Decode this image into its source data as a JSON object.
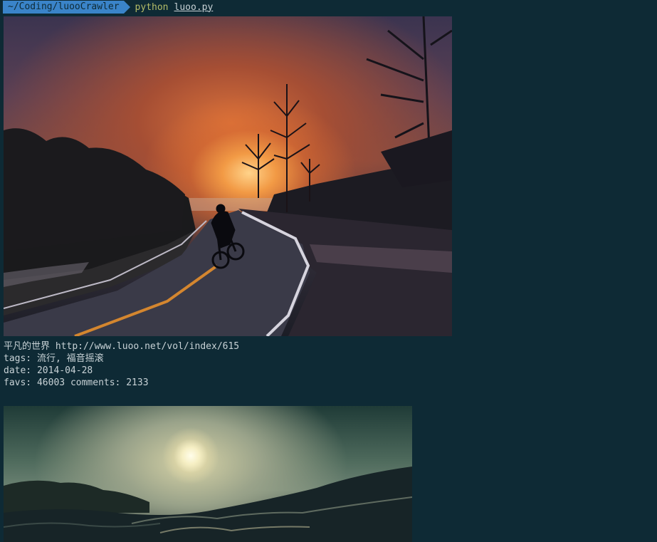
{
  "prompt": {
    "path": "~/Coding/luooCrawler",
    "command": "python",
    "argument": "luoo.py"
  },
  "entries": [
    {
      "title": "平凡的世界",
      "url": "http://www.luoo.net/vol/index/615",
      "tags_label": "tags:",
      "tags": "流行, 福音摇滚",
      "date_label": "date:",
      "date": "2014-04-28",
      "favs_label": "favs:",
      "favs": "46003",
      "comments_label": "comments:",
      "comments": "2133"
    }
  ],
  "colors": {
    "background": "#0e2a35",
    "prompt_path_bg": "#3a84c9",
    "command": "#b5bd68",
    "text": "#c8d2d6"
  }
}
